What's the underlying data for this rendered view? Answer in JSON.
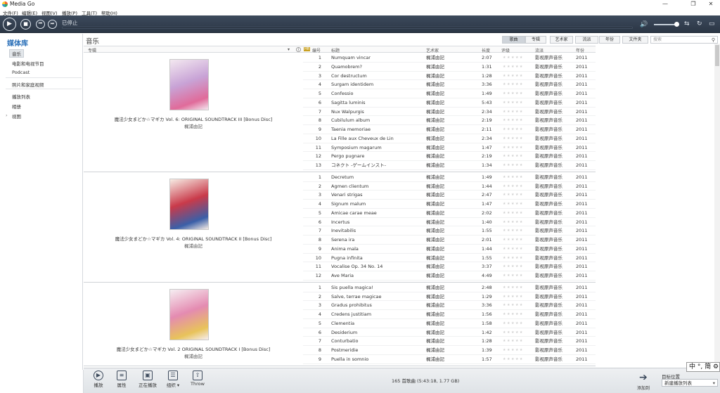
{
  "window": {
    "title": "Media Go",
    "min": "—",
    "max": "❐",
    "close": "✕"
  },
  "menu": [
    "文件(F)",
    "编辑(E)",
    "视图(V)",
    "播放(P)",
    "工具(T)",
    "帮助(H)"
  ],
  "transport": {
    "status": "已停止",
    "play": "▶",
    "stop": "■",
    "prev": "⏮",
    "next": "⏭",
    "volume_icon": "🔊",
    "icons": [
      "⇆",
      "↻",
      "▭"
    ]
  },
  "sidebar": {
    "title": "媒体库",
    "items": [
      "音乐",
      "电影和电视节目",
      "Podcast",
      "照片和家庭视频",
      "播放列表",
      "相册",
      "视图"
    ],
    "expander": "›"
  },
  "main": {
    "section": "音乐",
    "view_tabs": [
      "歌曲",
      "专辑",
      "艺术家",
      "流派",
      "年份",
      "文件夹"
    ],
    "search_placeholder": "搜索",
    "search_icon": "⚲",
    "columns": {
      "album": "专辑",
      "sort": "▾",
      "info": "i",
      "hr": "HR",
      "num": "编号",
      "title": "标题",
      "artist": "艺术家",
      "length": "长度",
      "rating": "评级",
      "genre": "流派",
      "year": "年份"
    }
  },
  "albums": [
    {
      "title": "魔法少女まどか☆マギカ Vol. 6: ORIGINAL SOUNDTRACK III [Bonus Disc]",
      "artist": "梶浦由記",
      "cover_colors": [
        "#f3e8f0",
        "#c8a3d6",
        "#e06b9a"
      ],
      "tracks": [
        [
          "1",
          "Numquam vincar",
          "梶浦由記",
          "2:07",
          "影视原声音乐",
          "2011"
        ],
        [
          "2",
          "Quamobrem?",
          "梶浦由記",
          "1:31",
          "影视原声音乐",
          "2011"
        ],
        [
          "3",
          "Cor destructum",
          "梶浦由記",
          "1:28",
          "影视原声音乐",
          "2011"
        ],
        [
          "4",
          "Surgam identidem",
          "梶浦由記",
          "3:36",
          "影视原声音乐",
          "2011"
        ],
        [
          "5",
          "Confessio",
          "梶浦由記",
          "1:49",
          "影视原声音乐",
          "2011"
        ],
        [
          "6",
          "Sagitta luminis",
          "梶浦由記",
          "5:43",
          "影视原声音乐",
          "2011"
        ],
        [
          "7",
          "Nux Walpurgis",
          "梶浦由記",
          "2:34",
          "影视原声音乐",
          "2011"
        ],
        [
          "8",
          "Cubilulum album",
          "梶浦由記",
          "2:19",
          "影视原声音乐",
          "2011"
        ],
        [
          "9",
          "Taenia memoriae",
          "梶浦由記",
          "2:11",
          "影视原声音乐",
          "2011"
        ],
        [
          "10",
          "La Fille aux Cheveux de Lin",
          "梶浦由記",
          "2:34",
          "影视原声音乐",
          "2011"
        ],
        [
          "11",
          "Symposium magarum",
          "梶浦由記",
          "1:47",
          "影视原声音乐",
          "2011"
        ],
        [
          "12",
          "Pergo pugnare",
          "梶浦由記",
          "2:19",
          "影视原声音乐",
          "2011"
        ],
        [
          "13",
          "コネクト -ゲームインスト-",
          "梶浦由記",
          "1:34",
          "影视原声音乐",
          "2011"
        ]
      ]
    },
    {
      "title": "魔法少女まどか☆マギカ Vol. 4: ORIGINAL SOUNDTRACK II [Bonus Disc]",
      "artist": "梶浦由記",
      "cover_colors": [
        "#f7ece4",
        "#c93a4a",
        "#3a5fa8"
      ],
      "tracks": [
        [
          "1",
          "Decretum",
          "梶浦由記",
          "1:49",
          "影视原声音乐",
          "2011"
        ],
        [
          "2",
          "Agmen clientum",
          "梶浦由記",
          "1:44",
          "影视原声音乐",
          "2011"
        ],
        [
          "3",
          "Venari strigas",
          "梶浦由記",
          "2:47",
          "影视原声音乐",
          "2011"
        ],
        [
          "4",
          "Signum malum",
          "梶浦由記",
          "1:47",
          "影视原声音乐",
          "2011"
        ],
        [
          "5",
          "Amicae carae meae",
          "梶浦由記",
          "2:02",
          "影视原声音乐",
          "2011"
        ],
        [
          "6",
          "Incertus",
          "梶浦由記",
          "1:40",
          "影视原声音乐",
          "2011"
        ],
        [
          "7",
          "Inevitabilis",
          "梶浦由記",
          "1:55",
          "影视原声音乐",
          "2011"
        ],
        [
          "8",
          "Serena ira",
          "梶浦由記",
          "2:01",
          "影视原声音乐",
          "2011"
        ],
        [
          "9",
          "Anima mala",
          "梶浦由記",
          "1:44",
          "影视原声音乐",
          "2011"
        ],
        [
          "10",
          "Pugna infinita",
          "梶浦由記",
          "1:55",
          "影视原声音乐",
          "2011"
        ],
        [
          "11",
          "Vocalise Op. 34 No. 14",
          "梶浦由記",
          "3:37",
          "影视原声音乐",
          "2011"
        ],
        [
          "12",
          "Ave Maria",
          "梶浦由記",
          "4:49",
          "影视原声音乐",
          "2011"
        ]
      ]
    },
    {
      "title": "魔法少女まどか☆マギカ Vol. 2 ORIGINAL SOUNDTRACK I [Bonus Disc]",
      "artist": "梶浦由記",
      "cover_colors": [
        "#f6eef2",
        "#e48bb1",
        "#e8c35a"
      ],
      "tracks": [
        [
          "1",
          "Sis puella magica!",
          "梶浦由記",
          "2:48",
          "影视原声音乐",
          "2011"
        ],
        [
          "2",
          "Salve, terrae magicae",
          "梶浦由記",
          "1:29",
          "影视原声音乐",
          "2011"
        ],
        [
          "3",
          "Gradus prohibitus",
          "梶浦由記",
          "3:36",
          "影视原声音乐",
          "2011"
        ],
        [
          "4",
          "Credens justitiam",
          "梶浦由記",
          "1:56",
          "影视原声音乐",
          "2011"
        ],
        [
          "5",
          "Clementia",
          "梶浦由記",
          "1:58",
          "影视原声音乐",
          "2011"
        ],
        [
          "6",
          "Desiderium",
          "梶浦由記",
          "1:42",
          "影视原声音乐",
          "2011"
        ],
        [
          "7",
          "Conturbatio",
          "梶浦由記",
          "1:28",
          "影视原声音乐",
          "2011"
        ],
        [
          "8",
          "Postmeridie",
          "梶浦由記",
          "1:39",
          "影视原声音乐",
          "2011"
        ],
        [
          "9",
          "Puella in somnio",
          "梶浦由記",
          "1:57",
          "影视原声音乐",
          "2011"
        ]
      ]
    }
  ],
  "rating_stars": "★★★★★",
  "bottom": {
    "buttons": [
      "播放",
      "属性",
      "正在播放",
      "组织 ▾",
      "Throw"
    ],
    "button_icons": [
      "▶",
      "≡",
      "▣",
      "☰",
      "⇧"
    ],
    "summary": "165 首歌曲 (5:43:18, 1.77 GB)",
    "add_to": "添加到",
    "dest_title": "目标位置",
    "dest_value": "新建播放列表",
    "dest_arrow": "➔",
    "dropdown": "▾"
  },
  "ime": "中 °, 简 ⚙"
}
